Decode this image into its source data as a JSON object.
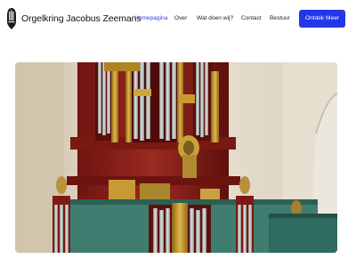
{
  "header": {
    "site_title": "Orgelkring Jacobus Zeemans",
    "logo_icon": "organ-pipes-icon",
    "cta_label": "Ontdek Meer"
  },
  "nav": {
    "items": [
      {
        "label": "Homepagina",
        "active": true
      },
      {
        "label": "Over",
        "active": false
      },
      {
        "label": "Wat doen wij?",
        "active": false
      },
      {
        "label": "Contact",
        "active": false
      },
      {
        "label": "Bestuur",
        "active": false
      }
    ]
  },
  "colors": {
    "accent": "#2336e8",
    "active_nav": "#2b3fd6"
  },
  "hero": {
    "image_subject": "church-pipe-organ-photo"
  }
}
